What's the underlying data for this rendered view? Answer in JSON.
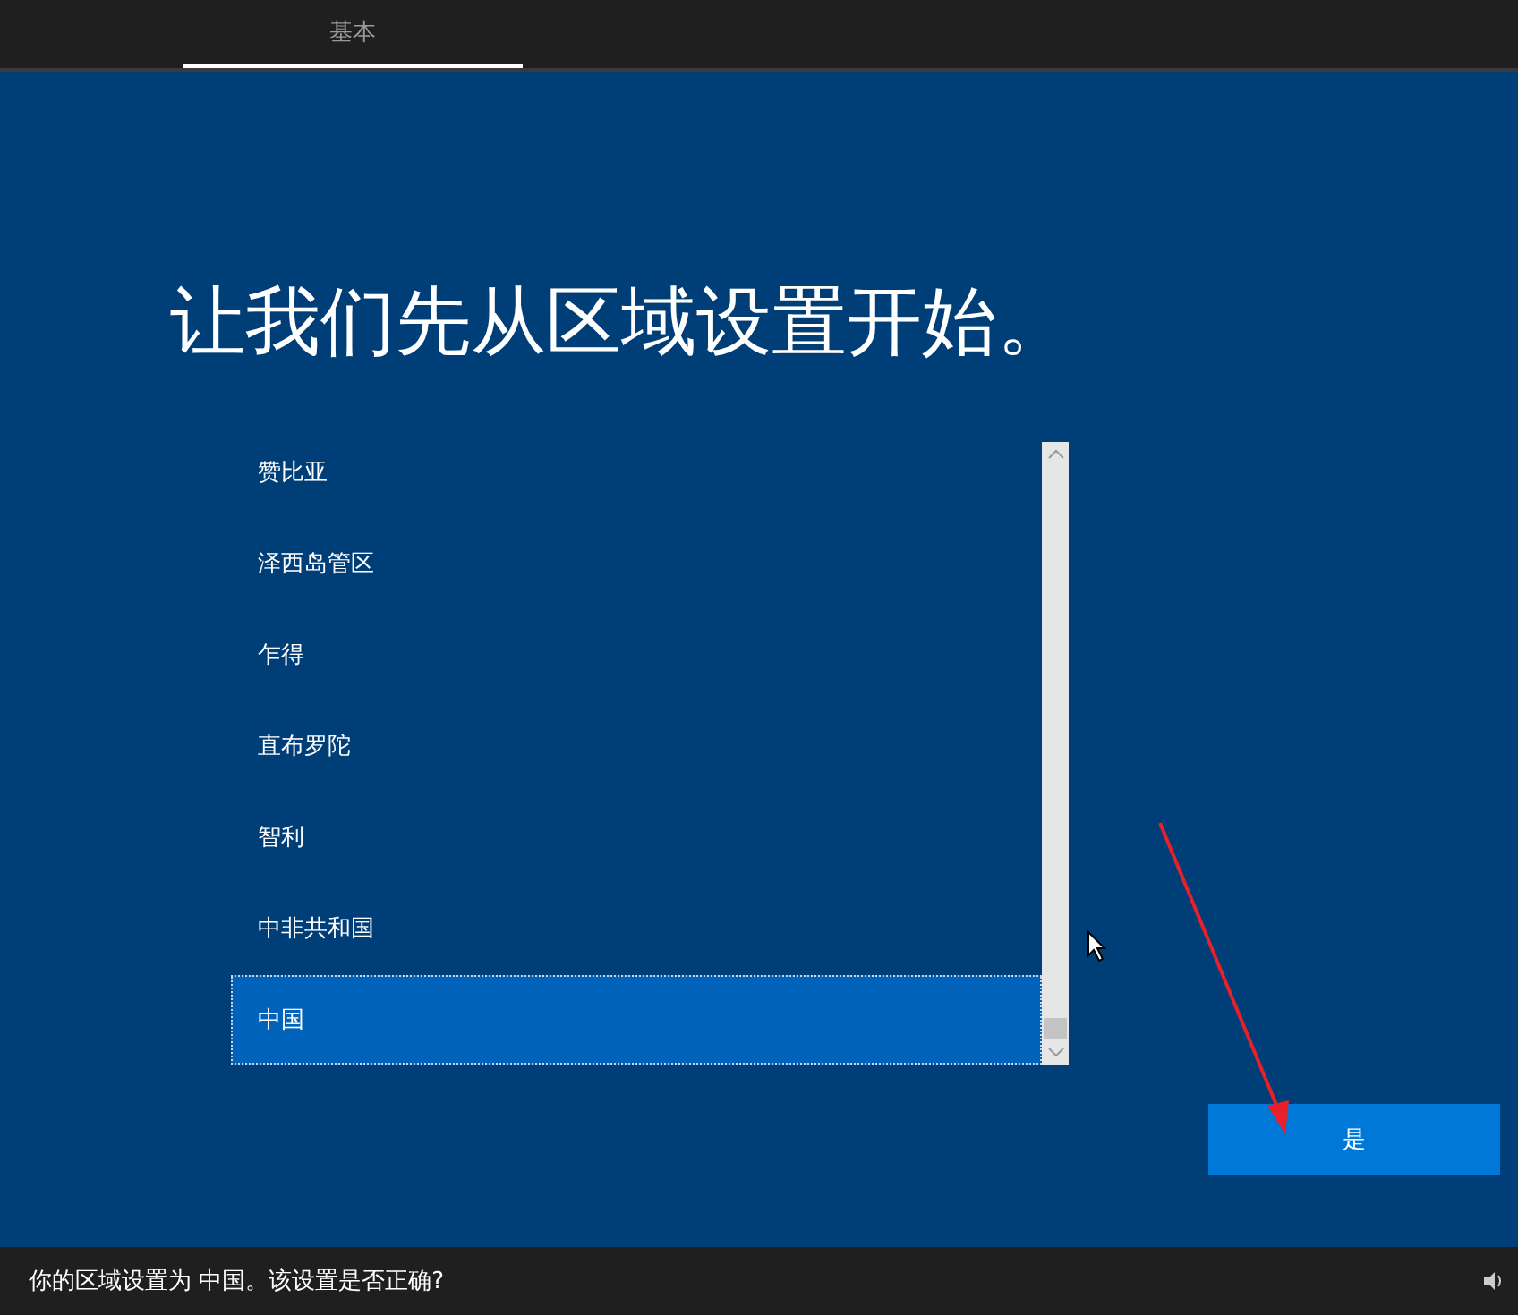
{
  "tabs": [
    {
      "label": "基本",
      "selected": true
    }
  ],
  "heading": "让我们先从区域设置开始。",
  "regions": [
    {
      "label": "赞比亚",
      "selected": false
    },
    {
      "label": "泽西岛管区",
      "selected": false
    },
    {
      "label": "乍得",
      "selected": false
    },
    {
      "label": "直布罗陀",
      "selected": false
    },
    {
      "label": "智利",
      "selected": false
    },
    {
      "label": "中非共和国",
      "selected": false
    },
    {
      "label": "中国",
      "selected": true
    }
  ],
  "buttons": [
    {
      "label": "是"
    }
  ],
  "status_bar": {
    "message": "你的区域设置为 中国。该设置是否正确?"
  }
}
